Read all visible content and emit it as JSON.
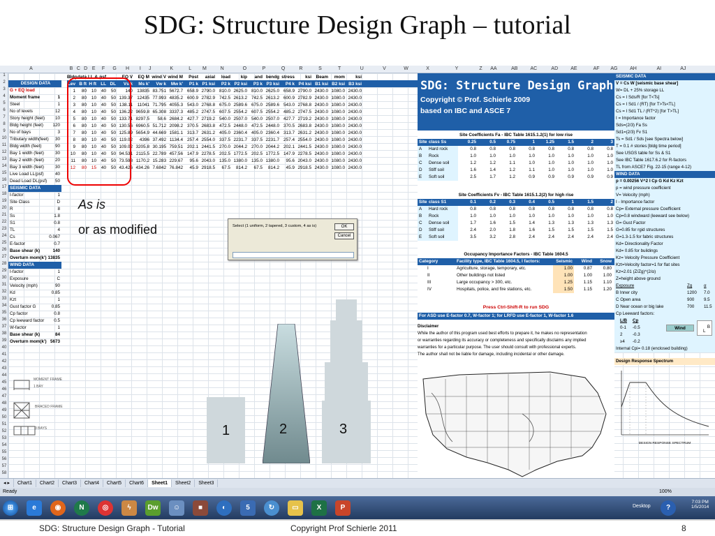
{
  "slide": {
    "title": "SDG: Structure Design Graph – tutorial",
    "as_is": "As is",
    "or_modified": "or as modified",
    "shape_labels": [
      "1",
      "2",
      "3"
    ],
    "footer_left": "SDG: Structure Design Graph - Tutorial",
    "footer_center": "Copyright Prof Schierle 2011",
    "footer_page": "8"
  },
  "columns": [
    "A",
    "B",
    "C",
    "D",
    "E",
    "F",
    "G",
    "H",
    "I",
    "J",
    "K",
    "L",
    "M",
    "N",
    "O",
    "P",
    "Q",
    "R",
    "S",
    "T",
    "U",
    "V",
    "W",
    "X",
    "Y",
    "Z",
    "AA",
    "AB",
    "AC",
    "AD",
    "AE",
    "AF",
    "AG",
    "AH",
    "AI",
    "AJ"
  ],
  "left_panel": {
    "title": "DESIGN DATA",
    "items": [
      {
        "label": "G + EQ load",
        "value": "",
        "cls": "red"
      },
      {
        "label": "Moment frame",
        "value": "1",
        "cls": "bold"
      },
      {
        "label": "Steel",
        "value": "1",
        "cls": ""
      },
      {
        "label": "No of levels",
        "value": "12",
        "cls": ""
      },
      {
        "label": "Story height (feet)",
        "value": "10",
        "cls": ""
      },
      {
        "label": "Bldg height (feet)",
        "value": "120",
        "cls": ""
      },
      {
        "label": "No of bays",
        "value": "3",
        "cls": ""
      },
      {
        "label": "Tributary width(feet)",
        "value": "30",
        "cls": ""
      },
      {
        "label": "Bldg width (feet)",
        "value": "90",
        "cls": ""
      },
      {
        "label": "Bay 1 width (feet)",
        "value": "30",
        "cls": ""
      },
      {
        "label": "Bay 2 width (feet)",
        "value": "20",
        "cls": ""
      },
      {
        "label": "Bay 3 width (feet)",
        "value": "30",
        "cls": ""
      },
      {
        "label": "Live Load LL(psf)",
        "value": "40",
        "cls": ""
      },
      {
        "label": "Dead Load DL(psf)",
        "value": "50",
        "cls": ""
      },
      {
        "label": "SEISMIC DATA",
        "value": "",
        "cls": "sect"
      },
      {
        "label": "I-factor",
        "value": "1",
        "cls": ""
      },
      {
        "label": "Site Class",
        "value": "D",
        "cls": ""
      },
      {
        "label": "R",
        "value": "8",
        "cls": ""
      },
      {
        "label": "Ss",
        "value": "1.8",
        "cls": ""
      },
      {
        "label": "S1",
        "value": "0.8",
        "cls": ""
      },
      {
        "label": "TL",
        "value": "4",
        "cls": ""
      },
      {
        "label": "Cs",
        "value": "0.067",
        "cls": ""
      },
      {
        "label": "E-factor",
        "value": "0.7",
        "cls": ""
      },
      {
        "label": "Base shear (k)",
        "value": "140",
        "cls": "bold"
      },
      {
        "label": "Overturn mom(k')",
        "value": "13835",
        "cls": "bold"
      },
      {
        "label": "WIND DATA",
        "value": "",
        "cls": "sect"
      },
      {
        "label": "I-factor",
        "value": "1",
        "cls": ""
      },
      {
        "label": "Exposure",
        "value": "C",
        "cls": ""
      },
      {
        "label": "Velocity (mph)",
        "value": "90",
        "cls": ""
      },
      {
        "label": "Kd",
        "value": "0.85",
        "cls": ""
      },
      {
        "label": "Kzt",
        "value": "1",
        "cls": ""
      },
      {
        "label": "Gust factor G",
        "value": "0.85",
        "cls": ""
      },
      {
        "label": "Cp factor",
        "value": "0.8",
        "cls": ""
      },
      {
        "label": "Cp leeward factor",
        "value": "0.5",
        "cls": ""
      },
      {
        "label": "W-factor",
        "value": "1",
        "cls": ""
      },
      {
        "label": "Base shear (k)",
        "value": "84",
        "cls": "bold"
      },
      {
        "label": "Overturn mom(k')",
        "value": "5673",
        "cls": "bold"
      }
    ]
  },
  "data_table": {
    "header1": [
      "Bldg",
      "data",
      "LL & DL",
      "psf",
      "",
      "EQ V",
      "EQ M",
      "wind V",
      "wind M",
      "Post",
      "axial",
      "load",
      "kip",
      "and",
      "bendg",
      "stress",
      "ksi",
      "Beam",
      "mom",
      "ksi"
    ],
    "header2": [
      "Lev",
      "B ft",
      "H ft",
      "LL",
      "DL",
      "Vs k",
      "Ms k'",
      "Vw k",
      "Mw k'",
      "P1 k",
      "P1 ksi",
      "P2 k",
      "P2 ksi",
      "P3 k",
      "P3 ksi",
      "P4 k",
      "P4 ksi",
      "B1 ksi",
      "B2 ksi",
      "B3 ksi"
    ],
    "rows": [
      [
        "1",
        "80",
        "10",
        "40",
        "50",
        "140",
        "13835",
        "83.751",
        "5672.7",
        "658.9",
        "2790.0",
        "810.0",
        "2625.0",
        "810.0",
        "2625.0",
        "658.9",
        "2790.0",
        "2430.0",
        "1080.0",
        "2430.0"
      ],
      [
        "2",
        "80",
        "10",
        "40",
        "50",
        "139.37",
        "12435",
        "77.993",
        "4835.2",
        "600.9",
        "2782.9",
        "742.5",
        "2613.2",
        "742.5",
        "2613.2",
        "600.9",
        "2782.9",
        "2430.0",
        "1080.0",
        "2430.0"
      ],
      [
        "3",
        "80",
        "10",
        "40",
        "50",
        "138.11",
        "11041",
        "71.795",
        "4055.3",
        "543.0",
        "2768.8",
        "675.0",
        "2589.6",
        "675.0",
        "2589.6",
        "543.0",
        "2768.8",
        "2430.0",
        "1080.0",
        "2430.0"
      ],
      [
        "4",
        "80",
        "10",
        "40",
        "50",
        "136.22",
        "9659.8",
        "65.308",
        "3337.3",
        "485.2",
        "2747.5",
        "607.5",
        "2554.2",
        "607.5",
        "2554.2",
        "485.2",
        "2747.5",
        "2430.0",
        "1080.0",
        "2430.0"
      ],
      [
        "5",
        "80",
        "10",
        "40",
        "50",
        "133.71",
        "8297.5",
        "58.6",
        "2684.2",
        "427.7",
        "2719.2",
        "540.0",
        "2507.0",
        "540.0",
        "2507.0",
        "427.7",
        "2719.2",
        "2430.0",
        "1080.0",
        "2430.0"
      ],
      [
        "6",
        "80",
        "10",
        "40",
        "50",
        "130.56",
        "6960.5",
        "51.712",
        "2098.2",
        "370.5",
        "2683.8",
        "472.5",
        "2448.0",
        "472.5",
        "2448.0",
        "370.5",
        "2683.8",
        "2430.0",
        "1080.0",
        "2430.0"
      ],
      [
        "7",
        "80",
        "10",
        "40",
        "50",
        "125.89",
        "5654.9",
        "44.669",
        "1581.1",
        "313.7",
        "2631.2",
        "405.0",
        "2360.4",
        "405.0",
        "2360.4",
        "313.7",
        "2631.2",
        "2430.0",
        "1080.0",
        "2430.0"
      ],
      [
        "8",
        "80",
        "10",
        "40",
        "50",
        "119.02",
        "4396",
        "37.492",
        "1134.4",
        "257.4",
        "2554.0",
        "337.5",
        "2231.7",
        "337.5",
        "2231.7",
        "257.4",
        "2554.0",
        "2430.0",
        "1080.0",
        "2430.0"
      ],
      [
        "9",
        "80",
        "10",
        "40",
        "50",
        "109.02",
        "3205.8",
        "30.195",
        "759.51",
        "202.1",
        "2441.5",
        "270.0",
        "2044.2",
        "270.0",
        "2044.2",
        "202.1",
        "2441.5",
        "2430.0",
        "1080.0",
        "2430.0"
      ],
      [
        "10",
        "80",
        "10",
        "40",
        "50",
        "94.531",
        "2115.5",
        "22.789",
        "457.56",
        "147.9",
        "2278.5",
        "202.5",
        "1772.5",
        "202.5",
        "1772.5",
        "147.9",
        "2278.5",
        "2430.0",
        "1080.0",
        "2430.0"
      ],
      [
        "11",
        "80",
        "10",
        "40",
        "50",
        "73.598",
        "1170.2",
        "15.283",
        "229.67",
        "95.6",
        "2043.0",
        "135.0",
        "1380.0",
        "135.0",
        "1380.0",
        "95.6",
        "2043.0",
        "2430.0",
        "1080.0",
        "2430.0"
      ],
      [
        "12",
        "80",
        "15",
        "40",
        "50",
        "43.426",
        "434.26",
        "7.6842",
        "76.842",
        "45.9",
        "2918.5",
        "67.5",
        "814.2",
        "67.5",
        "814.2",
        "45.9",
        "2918.5",
        "2430.0",
        "1080.0",
        "2430.0"
      ]
    ]
  },
  "dialog": {
    "message": "Select (1 uniform, 2 tapered, 3 custom, 4 as is)",
    "ok": "OK",
    "cancel": "Cancel"
  },
  "banner": {
    "title": "SDG: Structure Design Graph",
    "line1": "Copyright © Prof. Schierle 2009",
    "line2": "based on IBC and ASCE 7"
  },
  "fa_table": {
    "title": "Site Coefficients Fa - IBC Table 1615.1.2(1) for low rise",
    "headers": [
      "Site",
      "class Ss",
      "0.25",
      "0.5",
      "0.75",
      "1",
      "1.25",
      "1.5",
      "2",
      "3"
    ],
    "rows": [
      [
        "A",
        "Hard rock",
        "0.8",
        "0.8",
        "0.8",
        "0.8",
        "0.8",
        "0.8",
        "0.8",
        "0.8"
      ],
      [
        "B",
        "Rock",
        "1.0",
        "1.0",
        "1.0",
        "1.0",
        "1.0",
        "1.0",
        "1.0",
        "1.0"
      ],
      [
        "C",
        "Dense soil",
        "1.2",
        "1.2",
        "1.1",
        "1.0",
        "1.0",
        "1.0",
        "1.0",
        "1.0"
      ],
      [
        "D",
        "Stiff soil",
        "1.6",
        "1.4",
        "1.2",
        "1.1",
        "1.0",
        "1.0",
        "1.0",
        "1.0"
      ],
      [
        "E",
        "Soft soil",
        "2.5",
        "1.7",
        "1.2",
        "0.9",
        "0.9",
        "0.9",
        "0.9",
        "0.9"
      ]
    ]
  },
  "fv_table": {
    "title": "Site Coefficients Fv - IBC Table 1615.1.2(2) for high rise",
    "headers": [
      "Site",
      "class S1",
      "0.1",
      "0.2",
      "0.3",
      "0.4",
      "0.5",
      "1",
      "1.5",
      "2"
    ],
    "rows": [
      [
        "A",
        "Hard rock",
        "0.8",
        "0.8",
        "0.8",
        "0.8",
        "0.8",
        "0.8",
        "0.8",
        "0.8"
      ],
      [
        "B",
        "Rock",
        "1.0",
        "1.0",
        "1.0",
        "1.0",
        "1.0",
        "1.0",
        "1.0",
        "1.0"
      ],
      [
        "C",
        "Dense soil",
        "1.7",
        "1.6",
        "1.5",
        "1.4",
        "1.3",
        "1.3",
        "1.3",
        "1.3"
      ],
      [
        "D",
        "Stiff soil",
        "2.4",
        "2.0",
        "1.8",
        "1.6",
        "1.5",
        "1.5",
        "1.5",
        "1.5"
      ],
      [
        "E",
        "Soft soil",
        "3.5",
        "3.2",
        "2.8",
        "2.4",
        "2.4",
        "2.4",
        "2.4",
        "2.4"
      ]
    ]
  },
  "occ_table": {
    "title": "Occupancy Importance Factors - IBC Table 1604.5",
    "headers": [
      "Category",
      "Facility type, IBC Table 1604.5, I factors:",
      "Seismic",
      "Wind",
      "Snow"
    ],
    "rows": [
      [
        "I",
        "Agriculture, storage, temporary, etc.",
        "1.00",
        "0.87",
        "0.80"
      ],
      [
        "II",
        "Other buildings not listed",
        "1.00",
        "1.00",
        "1.00"
      ],
      [
        "III",
        "Large occupancy > 300, etc.",
        "1.25",
        "1.15",
        "1.10"
      ],
      [
        "IV",
        "Hospitals, police, and fire stations, etc.",
        "1.50",
        "1.15",
        "1.20"
      ]
    ]
  },
  "run": {
    "press": "Press Ctrl-Shift-R to run SDG",
    "asd": "For ASD use E-factor 0.7, W-factor 1; for LRFD use E-factor 1, W-factor 1.6"
  },
  "disclaimer": {
    "title": "Disclaimer",
    "lines": [
      "While the author of this program used best efforts to prepare it, he makes no representation",
      "or warranties regarding its accuracy or completeness and specifically disclaims any implied",
      "warranties for a particular purpose.  The user should consult with professional experts.",
      "The author shall not be liable for damage, including incidental or other damage."
    ]
  },
  "right_panel": {
    "lines": [
      {
        "t": "SEISMIC DATA",
        "cls": "rp-sect"
      },
      {
        "t": "V = Cs W     [seismic base shear]",
        "cls": "bold"
      },
      {
        "t": "W= DL + 25% storage LL",
        "cls": ""
      },
      {
        "t": "Cs = I Sds/R                 [for T<Ts]",
        "cls": ""
      },
      {
        "t": "Cs = I Sd1 / (RT)          [for T>Ts<TL]",
        "cls": ""
      },
      {
        "t": "Cs = I Sd1 TL / (RT^2)    [for T>TL]",
        "cls": ""
      },
      {
        "t": "I = Importance factor",
        "cls": ""
      },
      {
        "t": "Sds=(2/3) Fa Ss",
        "cls": ""
      },
      {
        "t": "Sd1=(2/3) Fv S1",
        "cls": ""
      },
      {
        "t": "Ts = Sd1 / Sds  [see Spectra below]",
        "cls": ""
      },
      {
        "t": "T = 0.1 # stories   [bldg time period]",
        "cls": ""
      },
      {
        "t": "See USGS table for Ss & S1",
        "cls": ""
      },
      {
        "t": "See IBC Table 1617.6.2 for R-factors",
        "cls": ""
      },
      {
        "t": "TL from ASCE7 Fig. 22-15 (range 4-12)",
        "cls": ""
      },
      {
        "t": "WIND DATA",
        "cls": "rp-sect"
      },
      {
        "t": "p = 0.00256 V^2 I Cp G Kd Kz Kzt",
        "cls": "bold"
      },
      {
        "t": "p = wind pressure coefficient",
        "cls": ""
      },
      {
        "t": "V= Velocity (mph)",
        "cls": ""
      },
      {
        "t": "I - Importance factor",
        "cls": ""
      },
      {
        "t": "Cp= External pressure Coefficient",
        "cls": ""
      },
      {
        "t": "Cp=0.8 windward (leeward see below)",
        "cls": ""
      },
      {
        "t": "G= Gust Factor",
        "cls": ""
      },
      {
        "t": "G=0.85 for rgid structures",
        "cls": ""
      },
      {
        "t": "G=1.3-1.5 for fabric structures",
        "cls": ""
      },
      {
        "t": "Kd= Directionality Factor",
        "cls": ""
      },
      {
        "t": "Kd= 0.85 for buildings",
        "cls": ""
      },
      {
        "t": "Kz= Velocity Pressure Coefficient",
        "cls": ""
      },
      {
        "t": "Kzt=Velocity factor=1 for flat sites",
        "cls": ""
      },
      {
        "t": "Kz=2.01 (Z/Zg)^(2/α)",
        "cls": ""
      },
      {
        "t": "Z=height above ground",
        "cls": ""
      }
    ],
    "exposure_header": [
      "Exposure",
      "Zg",
      "α"
    ],
    "exposure_rows": [
      [
        "B  Inner city",
        "1200",
        "7.0"
      ],
      [
        "C  Open area",
        "900",
        "9.5"
      ],
      [
        "D  Near ocean or big lake",
        "700",
        "11.5"
      ]
    ],
    "cp_leeward": "Cp    Leeward factors:",
    "lb_header": [
      "L/B",
      "Cp"
    ],
    "lb_rows": [
      [
        "0-1",
        "-0.5"
      ],
      [
        "2",
        "-0.3"
      ],
      [
        "≥4",
        "-0.2"
      ]
    ],
    "wind_label": "Wind",
    "b_label": "B",
    "l_label": "L",
    "internal_cp": "Internal Cpi= 0.18 (enclosed building)",
    "spectrum_title": "Design Response Spectrum",
    "spectrum_caption": "DESIGN RESPONSE SPECTRUM"
  },
  "frame_labels": {
    "moment": "MOMENT FRAME",
    "braced": "BRACED FRAME",
    "bays": "3 BAYS",
    "bay1": "1 BAY"
  },
  "sheet_tabs": [
    "Chart1",
    "Chart2",
    "Chart3",
    "Chart4",
    "Chart5",
    "Chart6",
    "Sheet1",
    "Sheet2",
    "Sheet3"
  ],
  "active_tab": "Sheet1",
  "status": {
    "ready": "Ready",
    "zoom": "100%"
  },
  "taskbar": {
    "desktop": "Desktop",
    "time": "7:03 PM",
    "date": "1/5/2014"
  }
}
